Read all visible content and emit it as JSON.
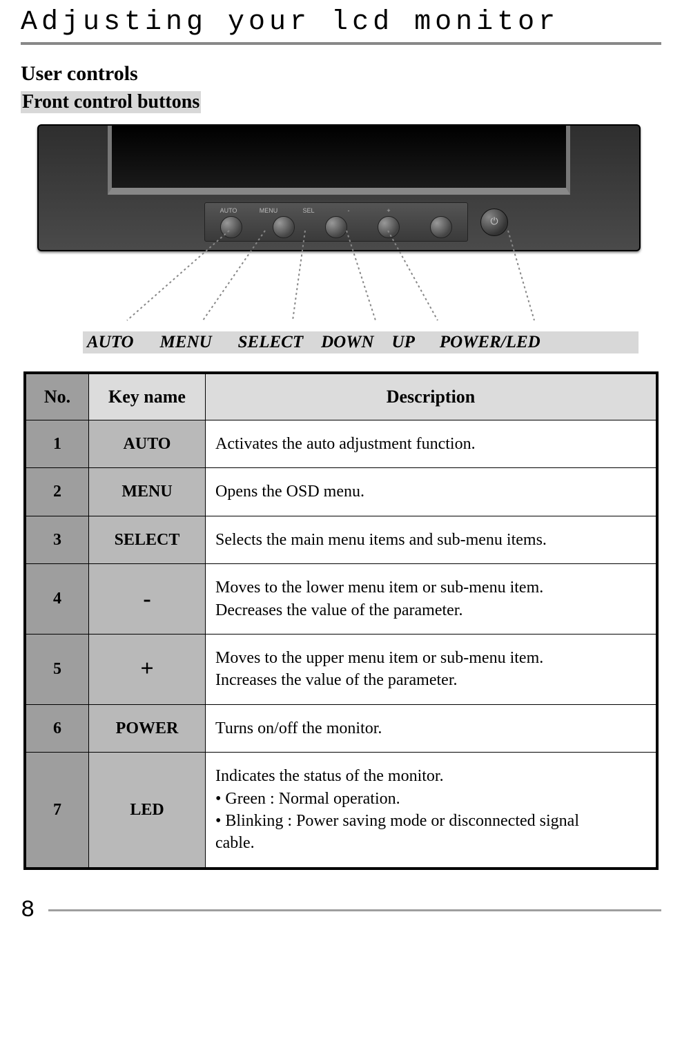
{
  "title": "Adjusting your lcd monitor",
  "section": "User controls",
  "subsection": "Front control buttons",
  "labels": {
    "auto": "AUTO",
    "menu": "MENU",
    "select": "SELECT",
    "down": "DOWN",
    "up": "UP",
    "power": "POWER/LED"
  },
  "panel_labels": {
    "auto": "AUTO",
    "menu": "MENU",
    "sel": "SEL",
    "minus": "-",
    "plus": "+"
  },
  "table": {
    "headers": {
      "no": "No.",
      "key": "Key name",
      "desc": "Description"
    },
    "rows": [
      {
        "no": "1",
        "key": "AUTO",
        "sym": false,
        "desc": "Activates the auto adjustment function."
      },
      {
        "no": "2",
        "key": "MENU",
        "sym": false,
        "desc": "Opens the OSD menu."
      },
      {
        "no": "3",
        "key": "SELECT",
        "sym": false,
        "desc": "Selects the main menu items and sub-menu items."
      },
      {
        "no": "4",
        "key": "-",
        "sym": true,
        "desc": "Moves to the lower menu item or sub-menu item.\nDecreases the value of the parameter."
      },
      {
        "no": "5",
        "key": "+",
        "sym": true,
        "desc": "Moves to the upper menu item or sub-menu item.\nIncreases the value of the parameter."
      },
      {
        "no": "6",
        "key": "POWER",
        "sym": false,
        "desc": "Turns on/off the monitor."
      },
      {
        "no": "7",
        "key": "LED",
        "sym": false,
        "desc": "Indicates the status of the monitor.\n • Green      : Normal operation.\n • Blinking : Power saving mode or disconnected signal\n                   cable."
      }
    ]
  },
  "page_number": "8"
}
